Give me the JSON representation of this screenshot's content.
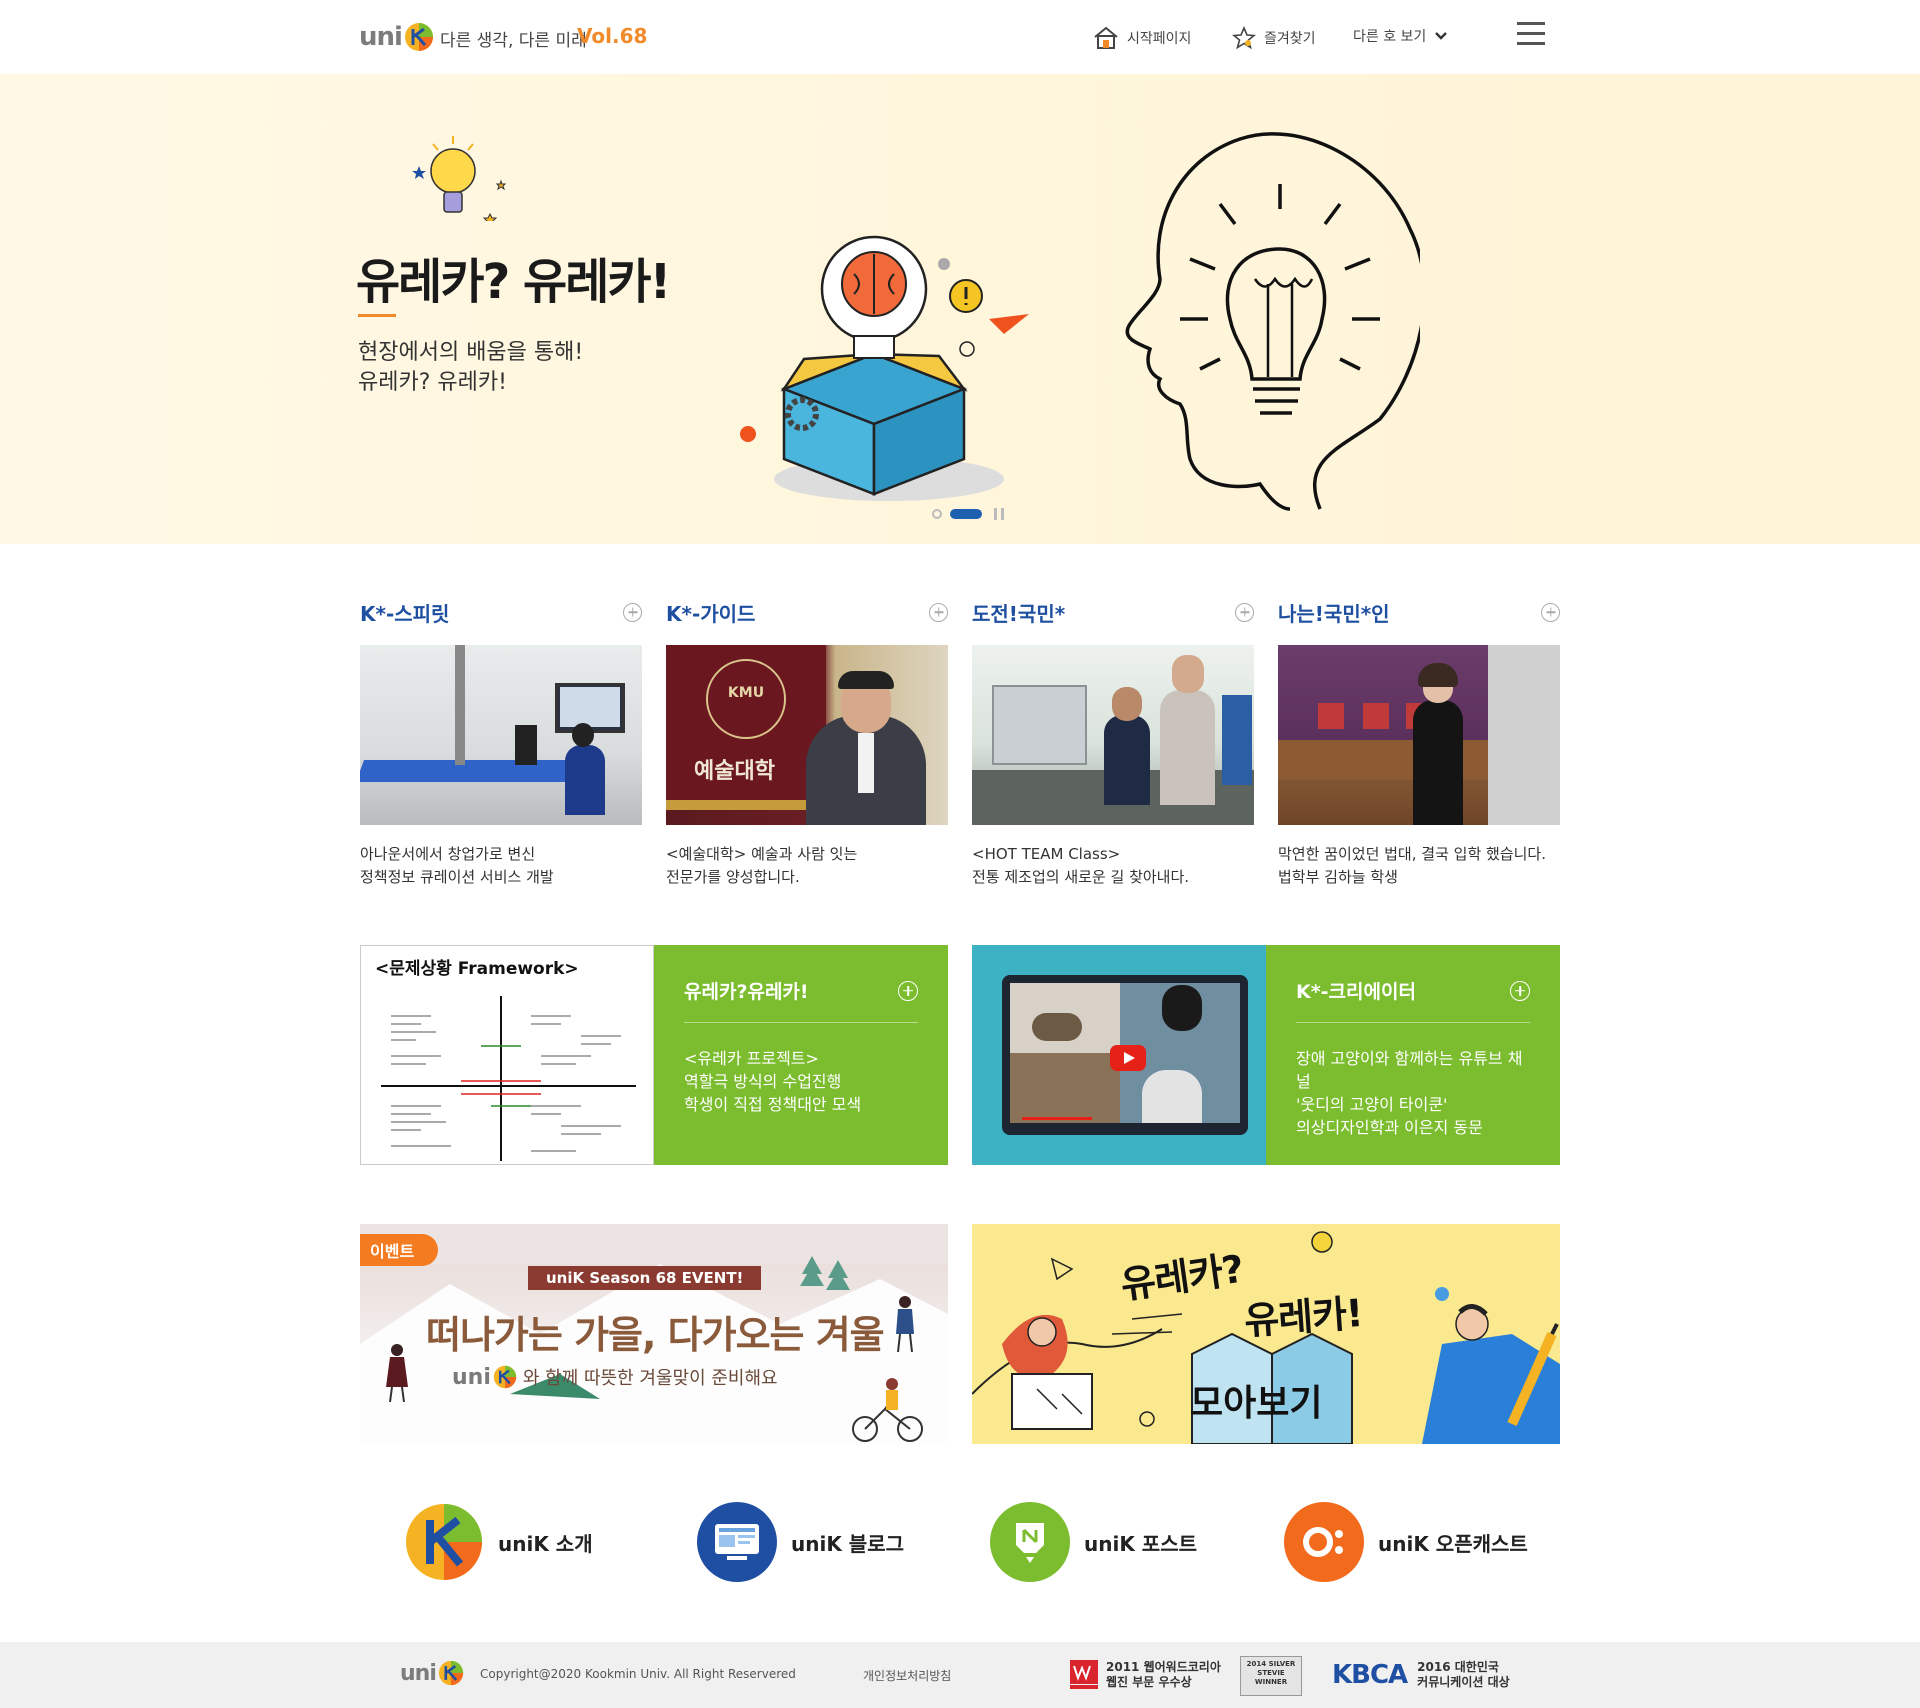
{
  "header": {
    "logo": "uni",
    "tagline": "다른 생각, 다른 미래",
    "volume": "Vol.68",
    "nav": [
      {
        "label": "시작페이지",
        "icon": "home-icon"
      },
      {
        "label": "즐겨찾기",
        "icon": "star-icon"
      },
      {
        "label": "다른 호 보기",
        "icon": "chevron-down-icon"
      }
    ],
    "menu_icon": "hamburger-menu-icon"
  },
  "hero": {
    "title": "유레카? 유레카!",
    "subtitle_line1": "현장에서의 배움을 통해!",
    "subtitle_line2": "유레카? 유레카!"
  },
  "categories": [
    {
      "title": "K*-스피릿",
      "desc_line1": "아나운서에서 창업가로 변신",
      "desc_line2": "정책정보 큐레이션 서비스 개발"
    },
    {
      "title": "K*-가이드",
      "desc_line1": "<예술대학> 예술과 사람 잇는",
      "desc_line2": "전문가를 양성합니다.",
      "img_text": "예술대학",
      "seal_text": "KMU"
    },
    {
      "title": "도전!국민*",
      "desc_line1": "<HOT TEAM Class>",
      "desc_line2": "전통 제조업의 새로운 길 찾아내다."
    },
    {
      "title": "나는!국민*인",
      "desc_line1": "막연한 꿈이었던 법대, 결국 입학 했습니다.",
      "desc_line2": "법학부 김하늘 학생"
    }
  ],
  "features": [
    {
      "title": "유레카?유레카!",
      "img_title": "<문제상황 Framework>",
      "desc": [
        "<유레카 프로젝트>",
        "역할극 방식의 수업진행",
        "학생이 직접 정책대안 모색"
      ]
    },
    {
      "title": "K*-크리에이터",
      "desc": [
        "장애 고양이와 함께하는 유튜브 채널",
        "'웃디의 고양이 타이쿤'",
        "의상디자인학과 이은지 동문"
      ]
    }
  ],
  "banners": {
    "event_tag": "이벤트",
    "event_ribbon": "uniK Season 68 EVENT!",
    "event_title": "떠나가는 가을, 다가오는 겨울",
    "event_sub_logo": "uni",
    "event_sub": "와 함께 따뜻한 겨울맞이 준비해요",
    "eureka_line1": "유레카?",
    "eureka_line2": "유레카!",
    "eureka_box": "모아보기"
  },
  "quick_links": [
    {
      "label": "uniK 소개",
      "color": "#ffffff"
    },
    {
      "label": "uniK 블로그",
      "color": "#1f4fa3"
    },
    {
      "label": "uniK 포스트",
      "color": "#7cbd2f"
    },
    {
      "label": "uniK 오픈캐스트",
      "color": "#f26a1b"
    }
  ],
  "footer": {
    "logo": "uni",
    "copyright": "Copyright@2020 Kookmin Univ. All Right Reservered",
    "privacy": "개인정보처리방침",
    "award1_line1": "2011 웹어워드코리아",
    "award1_line2": "웹진 부문 우수상",
    "award2": "2014 SILVER STEVIE WINNER",
    "award3_logo": "KBCA",
    "award3_line1": "2016 대한민국",
    "award3_line2": "커뮤니케이션 대상"
  }
}
